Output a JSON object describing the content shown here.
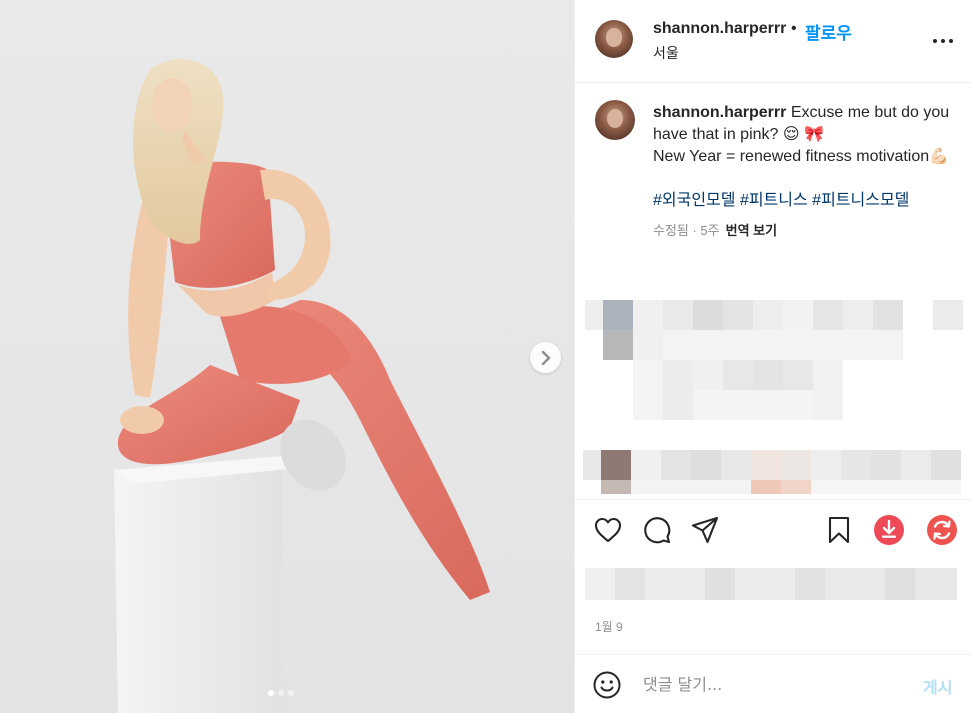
{
  "post": {
    "username": "shannon.harperrr",
    "separator": "•",
    "follow_label": "팔로우",
    "location": "서울",
    "caption_line1": "Excuse me but do you have that in pink? 😌 🎀",
    "caption_line2": "New Year = renewed fitness motivation💪🏻",
    "hashtags": "#외국인모델 #피트니스 #피트니스모델",
    "edited_age": "수정됨 · 5주",
    "translate_label": "번역 보기",
    "date": "1월 9",
    "carousel": {
      "count": 3,
      "active_index": 0
    }
  },
  "actions": {
    "like": "heart-icon",
    "comment": "comment-icon",
    "share": "share-icon",
    "save": "bookmark-icon",
    "download": "download-icon",
    "refresh": "refresh-icon"
  },
  "comment_bar": {
    "placeholder": "댓글 달기...",
    "post_label": "게시"
  },
  "colors": {
    "accent": "#0095f6",
    "hashtag": "#00376b",
    "download_red": "#ed4956",
    "outfit_pink": "#e88476"
  }
}
